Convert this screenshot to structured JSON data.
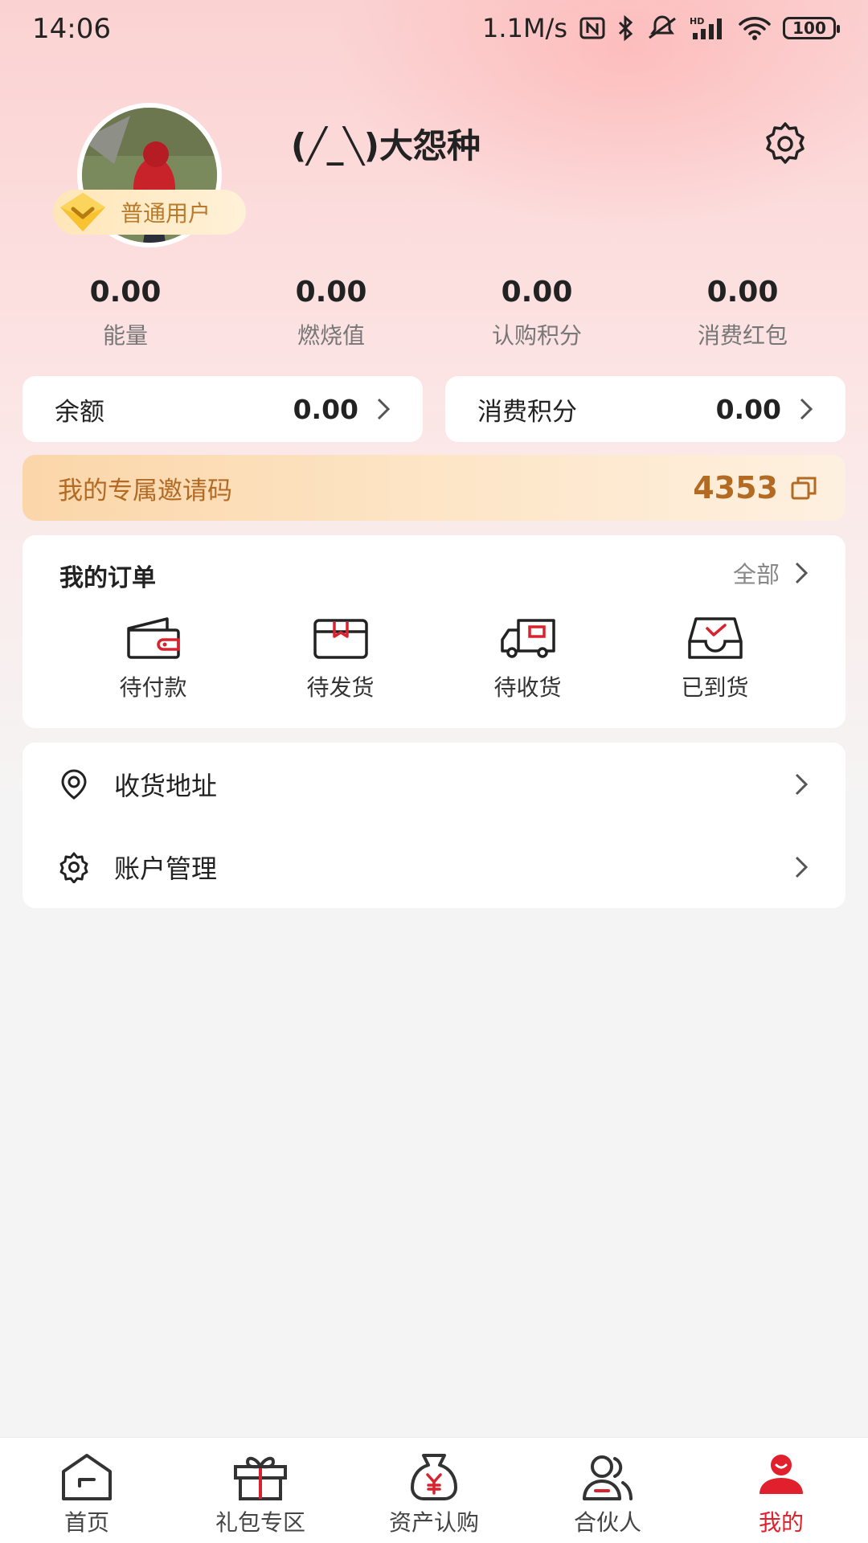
{
  "status_bar": {
    "time": "14:06",
    "network_speed": "1.1M/s",
    "battery": "100",
    "icons": [
      "nfc-icon",
      "bluetooth-icon",
      "mute-icon",
      "hd-signal-icon",
      "wifi-icon",
      "battery-icon"
    ]
  },
  "profile": {
    "username": "(╱_╲)大怨种",
    "badge_label": "普通用户",
    "avatar_desc": "avatar"
  },
  "stats": [
    {
      "value": "0.00",
      "label": "能量"
    },
    {
      "value": "0.00",
      "label": "燃烧值"
    },
    {
      "value": "0.00",
      "label": "认购积分"
    },
    {
      "value": "0.00",
      "label": "消费红包"
    }
  ],
  "balance_cards": [
    {
      "label": "余额",
      "value": "0.00"
    },
    {
      "label": "消费积分",
      "value": "0.00"
    }
  ],
  "invite": {
    "label": "我的专属邀请码",
    "code": "4353"
  },
  "orders": {
    "title": "我的订单",
    "all_label": "全部",
    "items": [
      {
        "label": "待付款",
        "icon": "wallet-icon"
      },
      {
        "label": "待发货",
        "icon": "box-icon"
      },
      {
        "label": "待收货",
        "icon": "truck-icon"
      },
      {
        "label": "已到货",
        "icon": "inbox-check-icon"
      }
    ]
  },
  "menu": [
    {
      "label": "收货地址",
      "icon": "location-pin-icon"
    },
    {
      "label": "账户管理",
      "icon": "gear-icon"
    }
  ],
  "bottom_nav": [
    {
      "label": "首页",
      "icon": "home-icon"
    },
    {
      "label": "礼包专区",
      "icon": "gift-icon"
    },
    {
      "label": "资产认购",
      "icon": "money-bag-icon"
    },
    {
      "label": "合伙人",
      "icon": "partner-icon"
    },
    {
      "label": "我的",
      "icon": "user-icon",
      "active": true
    }
  ],
  "colors": {
    "accent_red": "#e0202c",
    "invite_text": "#b36b24",
    "badge_text": "#b97a2b"
  }
}
